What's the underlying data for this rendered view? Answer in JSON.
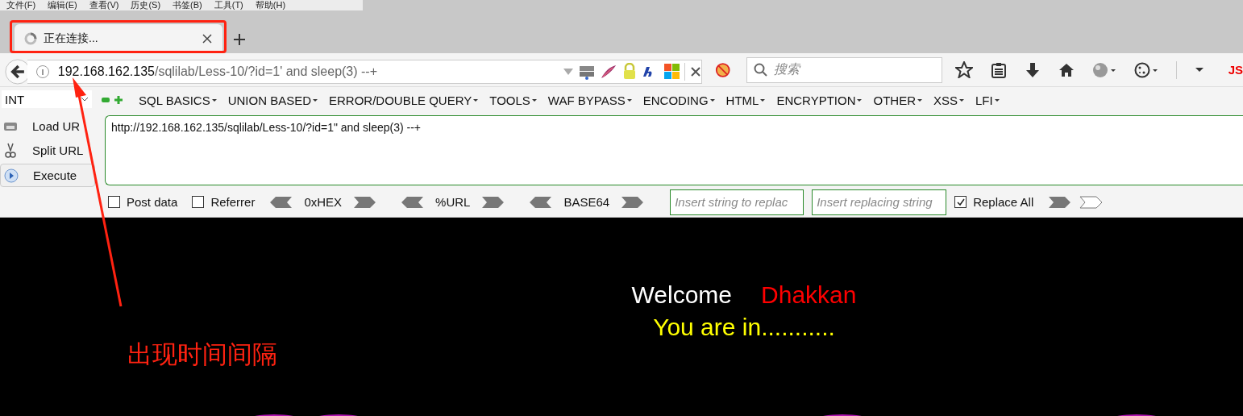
{
  "menu": [
    "文件(F)",
    "编辑(E)",
    "查看(V)",
    "历史(S)",
    "书签(B)",
    "工具(T)",
    "帮助(H)"
  ],
  "tabs": [
    {
      "title": "正在连接...",
      "selected": true,
      "loading": true
    }
  ],
  "address_bar": {
    "url_host": "192.168.162.135",
    "url_path": "/sqlilab/Less-10/?id=1' and sleep(3) --+"
  },
  "search": {
    "placeholder": "搜索"
  },
  "toolbar_extra": "JS",
  "hackbar": {
    "type_select": "INT",
    "menus": [
      "SQL BASICS",
      "UNION BASED",
      "ERROR/DOUBLE QUERY",
      "TOOLS",
      "WAF BYPASS",
      "ENCODING",
      "HTML",
      "ENCRYPTION",
      "OTHER",
      "XSS",
      "LFI"
    ],
    "actions": [
      "Load UR",
      "Split URL",
      "Execute"
    ],
    "url_text": "http://192.168.162.135/sqlilab/Less-10/?id=1\" and sleep(3) --+",
    "options": [
      {
        "label": "Post data",
        "checked": false
      },
      {
        "label": "Referrer",
        "checked": false
      }
    ],
    "encoders": [
      "0xHEX",
      "%URL",
      "BASE64"
    ],
    "replace_from": {
      "placeholder": "Insert string to replac"
    },
    "replace_to": {
      "placeholder": "Insert replacing string"
    },
    "replace_all": {
      "label": "Replace All",
      "checked": true
    }
  },
  "page": {
    "welcome": "Welcome",
    "name": "Dhakkan",
    "message": "You are in..........."
  },
  "annotation": {
    "text": "出现时间间隔"
  }
}
